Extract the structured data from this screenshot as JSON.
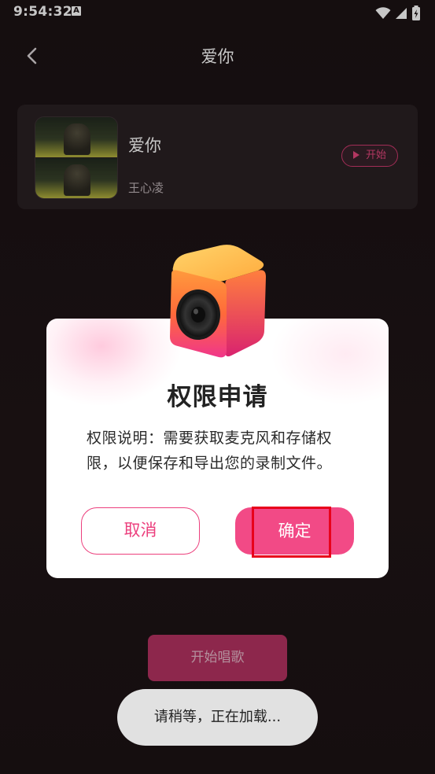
{
  "status_bar": {
    "time": "9:54:32",
    "notification_icon_letter": "A",
    "icons": [
      "wifi-icon",
      "signal-icon",
      "battery-charging-icon"
    ]
  },
  "header": {
    "title": "爱你",
    "back_icon": "chevron-left-icon"
  },
  "song": {
    "name": "爱你",
    "artist": "王心凌",
    "start_label": "开始"
  },
  "dialog": {
    "title": "权限申请",
    "message": "权限说明：需要获取麦克风和存储权限，以便保存和导出您的录制文件。",
    "cancel_label": "取消",
    "confirm_label": "确定",
    "icon": "speaker-cube-icon"
  },
  "bottom": {
    "sing_button_label": "开始唱歌",
    "toast": "请稍等，正在加载..."
  },
  "colors": {
    "background": "#1e1416",
    "card": "#2a2023",
    "accent_pink": "#f24a86",
    "sing_button": "#b53262",
    "highlight_box": "#e8001b"
  }
}
